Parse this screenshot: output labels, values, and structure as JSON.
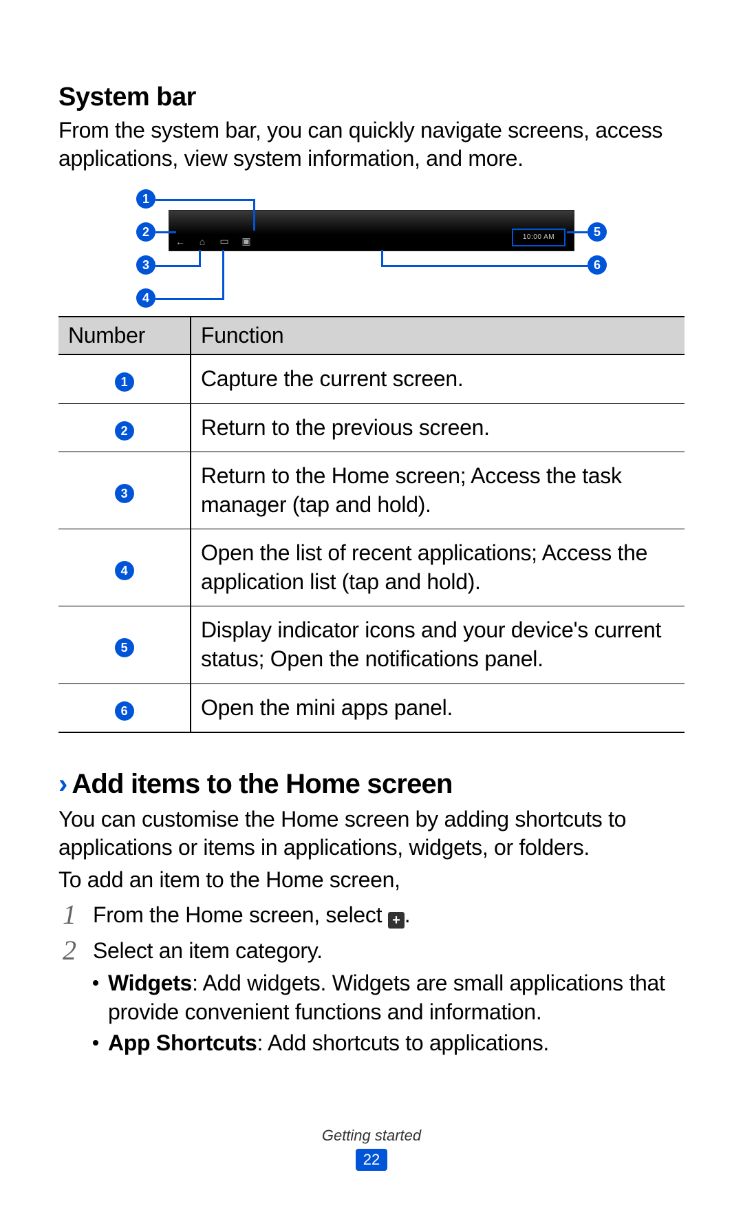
{
  "systemBar": {
    "title": "System bar",
    "intro": "From the system bar, you can quickly navigate screens, access applications, view system information, and more.",
    "timeDisplay": "10:00 AM"
  },
  "table": {
    "headers": {
      "number": "Number",
      "function": "Function"
    },
    "rows": [
      {
        "num": "1",
        "func": "Capture the current screen."
      },
      {
        "num": "2",
        "func": "Return to the previous screen."
      },
      {
        "num": "3",
        "func": "Return to the Home screen; Access the task manager (tap and hold)."
      },
      {
        "num": "4",
        "func": "Open the list of recent applications; Access the application list (tap and hold)."
      },
      {
        "num": "5",
        "func": "Display indicator icons and your device's current status; Open the notifications panel."
      },
      {
        "num": "6",
        "func": "Open the mini apps panel."
      }
    ]
  },
  "addItems": {
    "title": "Add items to the Home screen",
    "intro": "You can customise the Home screen by adding shortcuts to applications or items in applications, widgets, or folders.",
    "lead": "To add an item to the Home screen,",
    "step1_pre": "From the Home screen, select ",
    "step1_post": ".",
    "step2": "Select an item category.",
    "bullets": {
      "widgets_label": "Widgets",
      "widgets_text": ": Add widgets. Widgets are small applications that provide convenient functions and information.",
      "shortcuts_label": "App Shortcuts",
      "shortcuts_text": ": Add shortcuts to applications."
    }
  },
  "footer": {
    "section": "Getting started",
    "page": "22"
  }
}
